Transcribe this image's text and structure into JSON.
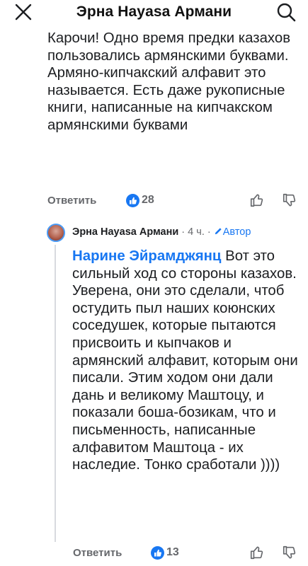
{
  "header": {
    "title": "Эрна Hayasa Армани",
    "close_icon": "close-icon",
    "search_icon": "search-icon"
  },
  "comment": {
    "text": "Карочи! Одно время предки казахов пользовались армянскими буквами. Армяно-кипчакский алфавит это называется. Есть даже рукописные книги, написанные на кипчакском армянскими буквами",
    "reply_label": "Ответить",
    "like_count": "28"
  },
  "reply": {
    "author": "Эрна Hayasa Армани",
    "time": "4 ч.",
    "separator": "·",
    "author_badge": "Автор",
    "mention": "Нарине Эйрамджянц",
    "text": " Вот это сильный ход со стороны казахов. Уверена, они это сделали, чтоб остудить пыл наших коюнских соседушек, которые пытаются присвоить и кыпчаков и армянский алфавит, которым они писали. Этим ходом они дали дань и великому Маштоцу, и показали боша-бозикам, что и письменность, написанные алфавитом Маштоца - их наследие. Тонко сработали ))))",
    "reply_label": "Ответить",
    "like_count": "13"
  },
  "colors": {
    "accent": "#1877f2",
    "secondary_text": "#65676b",
    "primary_text": "#1c1e21",
    "thread_line": "#d8dadf"
  }
}
